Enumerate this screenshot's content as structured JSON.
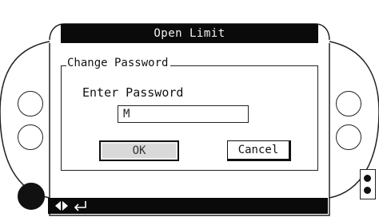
{
  "screen": {
    "title": "Open Limit"
  },
  "dialog": {
    "group_label": "Change Password",
    "prompt": "Enter Password",
    "password_value": "M",
    "ok_label": "OK",
    "cancel_label": "Cancel"
  },
  "footer": {
    "nav_glyph": "◆",
    "enter_glyph": "↵"
  },
  "colors": {
    "bar": "#0a0a0a",
    "ok_button_fill": "#d9d9d9",
    "soft_key_active": "#111111"
  },
  "icons": {
    "nav": "left-right-arrow-icon",
    "enter": "enter-arrow-icon"
  }
}
